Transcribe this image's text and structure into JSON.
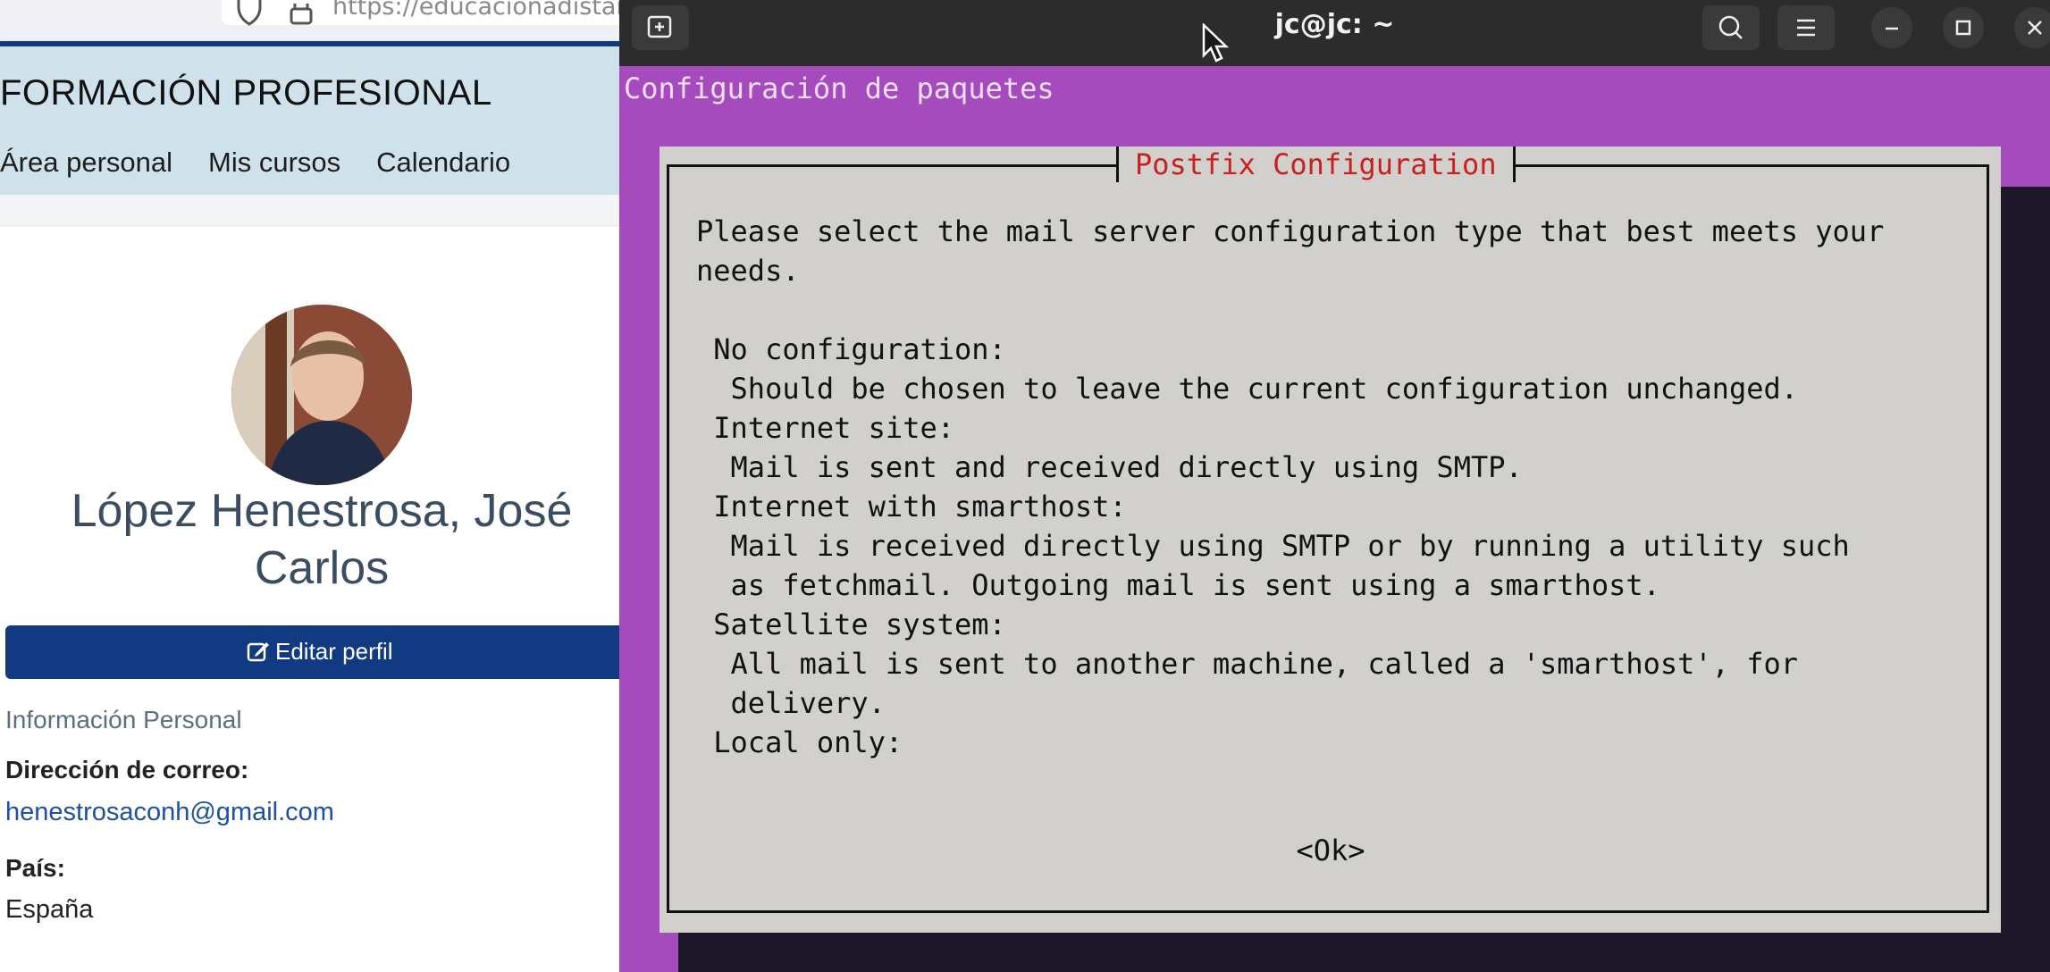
{
  "browser": {
    "url": "https://educacionadistancia",
    "site_title": "FORMACIÓN PROFESIONAL",
    "nav": [
      "Área personal",
      "Mis cursos",
      "Calendario"
    ],
    "profile": {
      "name": "López Henestrosa, José Carlos",
      "edit_button": "Editar perfil",
      "section_title": "Información Personal",
      "email_label": "Dirección de correo:",
      "email_value": "henestrosaconh@gmail.com",
      "country_label": "País:",
      "country_value": "España"
    }
  },
  "terminal": {
    "window_title": "jc@jc: ~",
    "package_title": "Configuración de paquetes",
    "dialog": {
      "title": "Postfix Configuration",
      "lines": [
        "Please select the mail server configuration type that best meets your",
        "needs.",
        "",
        " No configuration:",
        "  Should be chosen to leave the current configuration unchanged.",
        " Internet site:",
        "  Mail is sent and received directly using SMTP.",
        " Internet with smarthost:",
        "  Mail is received directly using SMTP or by running a utility such",
        "  as fetchmail. Outgoing mail is sent using a smarthost.",
        " Satellite system:",
        "  All mail is sent to another machine, called a 'smarthost', for",
        "  delivery.",
        " Local only:"
      ],
      "ok_button": "<Ok>"
    }
  },
  "colors": {
    "terminal_bg": "#a54bbd",
    "dialog_bg": "#d2d0cc",
    "dialog_title": "#c82020",
    "site_header": "#cfe2ec",
    "brand_blue": "#123a82"
  }
}
